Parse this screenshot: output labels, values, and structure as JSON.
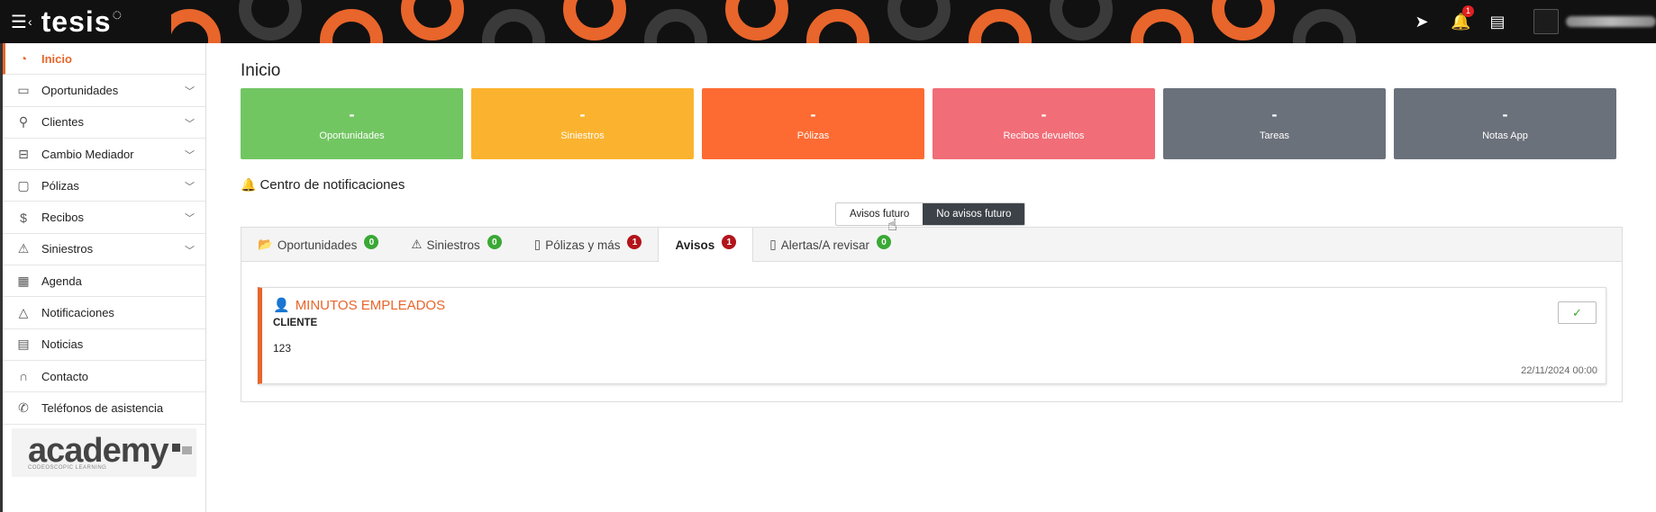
{
  "topbar": {
    "menu_icon": "hamburger-icon",
    "logo_text": "tesis",
    "notif_count": "1",
    "icons": [
      "send-icon",
      "bell-icon",
      "newspaper-icon"
    ]
  },
  "sidebar": {
    "items": [
      {
        "label": "Inicio",
        "icon": "home-icon"
      },
      {
        "label": "Oportunidades",
        "icon": "folder-icon"
      },
      {
        "label": "Clientes",
        "icon": "user-icon"
      },
      {
        "label": "Cambio Mediador",
        "icon": "briefcase-icon"
      },
      {
        "label": "Pólizas",
        "icon": "document-icon"
      },
      {
        "label": "Recibos",
        "icon": "dollar-icon"
      },
      {
        "label": "Siniestros",
        "icon": "warning-icon"
      },
      {
        "label": "Agenda",
        "icon": "calendar-icon"
      },
      {
        "label": "Notificaciones",
        "icon": "bell-icon"
      },
      {
        "label": "Noticias",
        "icon": "news-icon"
      },
      {
        "label": "Contacto",
        "icon": "headset-icon"
      },
      {
        "label": "Teléfonos de asistencia",
        "icon": "phone-icon"
      }
    ],
    "academy": {
      "word": "academy",
      "sub": "CODEOSCOPIC LEARNING"
    }
  },
  "main": {
    "title": "Inicio",
    "cards": [
      {
        "value": "-",
        "label": "Oportunidades",
        "color": "#72c662"
      },
      {
        "value": "-",
        "label": "Siniestros",
        "color": "#fbb32f"
      },
      {
        "value": "-",
        "label": "Pólizas",
        "color": "#fd6b33"
      },
      {
        "value": "-",
        "label": "Recibos devueltos",
        "color": "#f16d77"
      },
      {
        "value": "-",
        "label": "Tareas",
        "color": "#6b717b"
      },
      {
        "value": "-",
        "label": "Notas App",
        "color": "#6b717b"
      }
    ],
    "notif_center_title": "Centro de notificaciones",
    "toggle": {
      "left": "Avisos futuro",
      "right": "No avisos futuro"
    },
    "tabs": [
      {
        "label": "Oportunidades",
        "count": "0",
        "badge": "green",
        "icon": "folder-open-icon"
      },
      {
        "label": "Siniestros",
        "count": "0",
        "badge": "green",
        "icon": "warning-icon"
      },
      {
        "label": "Pólizas y más",
        "count": "1",
        "badge": "red",
        "icon": "file-icon"
      },
      {
        "label": "Avisos",
        "count": "1",
        "badge": "red",
        "icon": ""
      },
      {
        "label": "Alertas/A revisar",
        "count": "0",
        "badge": "green",
        "icon": "file-icon"
      }
    ],
    "notification": {
      "title": "MINUTOS EMPLEADOS",
      "subtitle": "CLIENTE",
      "body": "123",
      "date": "22/11/2024 00:00"
    }
  }
}
